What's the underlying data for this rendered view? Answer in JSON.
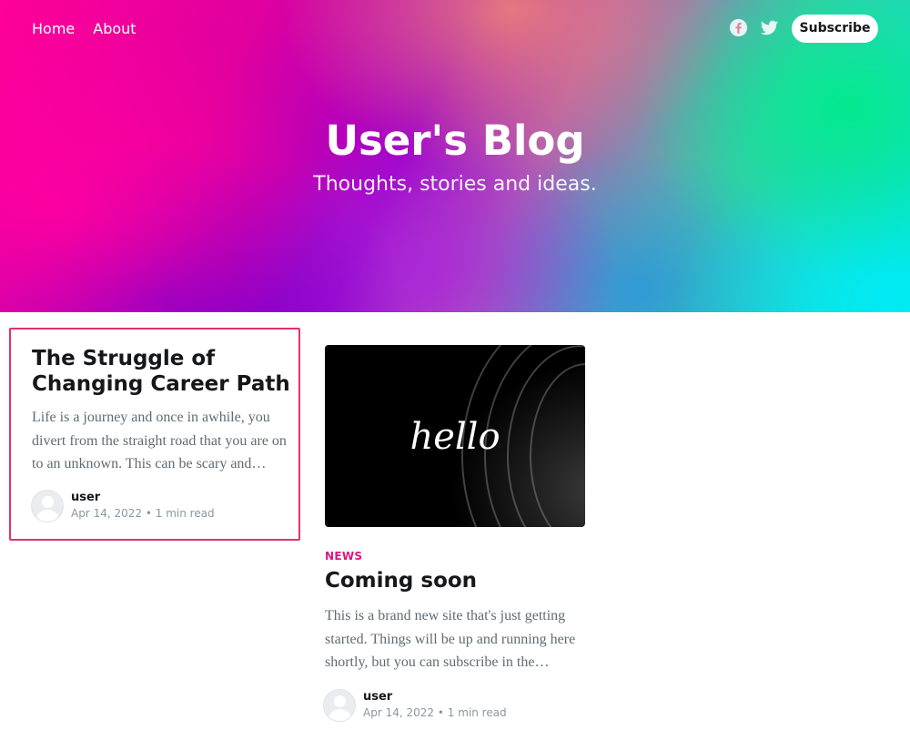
{
  "nav": {
    "items": [
      "Home",
      "About"
    ]
  },
  "social": {
    "facebook_icon": "facebook-icon",
    "twitter_icon": "twitter-icon"
  },
  "subscribe_label": "Subscribe",
  "site": {
    "title": "User's Blog",
    "description": "Thoughts, stories and ideas."
  },
  "posts": [
    {
      "title": "The Struggle of Changing Career Path",
      "excerpt": "Life is a journey and once in awhile, you divert from the straight road that you are on to an unknown. This can be scary and…",
      "author": "user",
      "date": "Apr 14, 2022",
      "reading_time": "1 min read"
    },
    {
      "tag": "NEWS",
      "image_text": "hello",
      "title": "Coming soon",
      "excerpt": "This is a brand new site that's just getting started. Things will be up and running here shortly, but you can subscribe in the…",
      "author": "user",
      "date": "Apr 14, 2022",
      "reading_time": "1 min read"
    }
  ],
  "colors": {
    "highlight_border": "#e0326e",
    "tag": "#e0157a"
  }
}
